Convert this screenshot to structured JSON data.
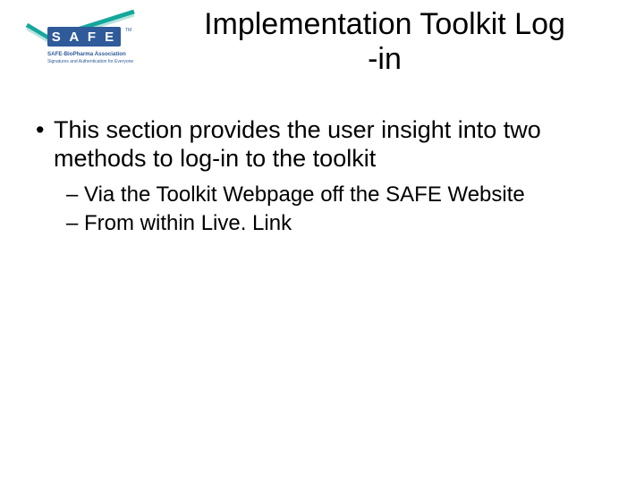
{
  "logo": {
    "brand_text": "S A F E",
    "tagline1": "SAFE-BioPharma Association",
    "tagline2": "Signatures and Authentication for Everyone",
    "tm": "TM"
  },
  "title": {
    "line1": "Implementation Toolkit Log",
    "line2": "-in"
  },
  "body": {
    "item1": "This section provides the user insight into two methods to log-in to the toolkit",
    "sub1": "Via the Toolkit Webpage off the SAFE Website",
    "sub2": "From within Live. Link"
  }
}
